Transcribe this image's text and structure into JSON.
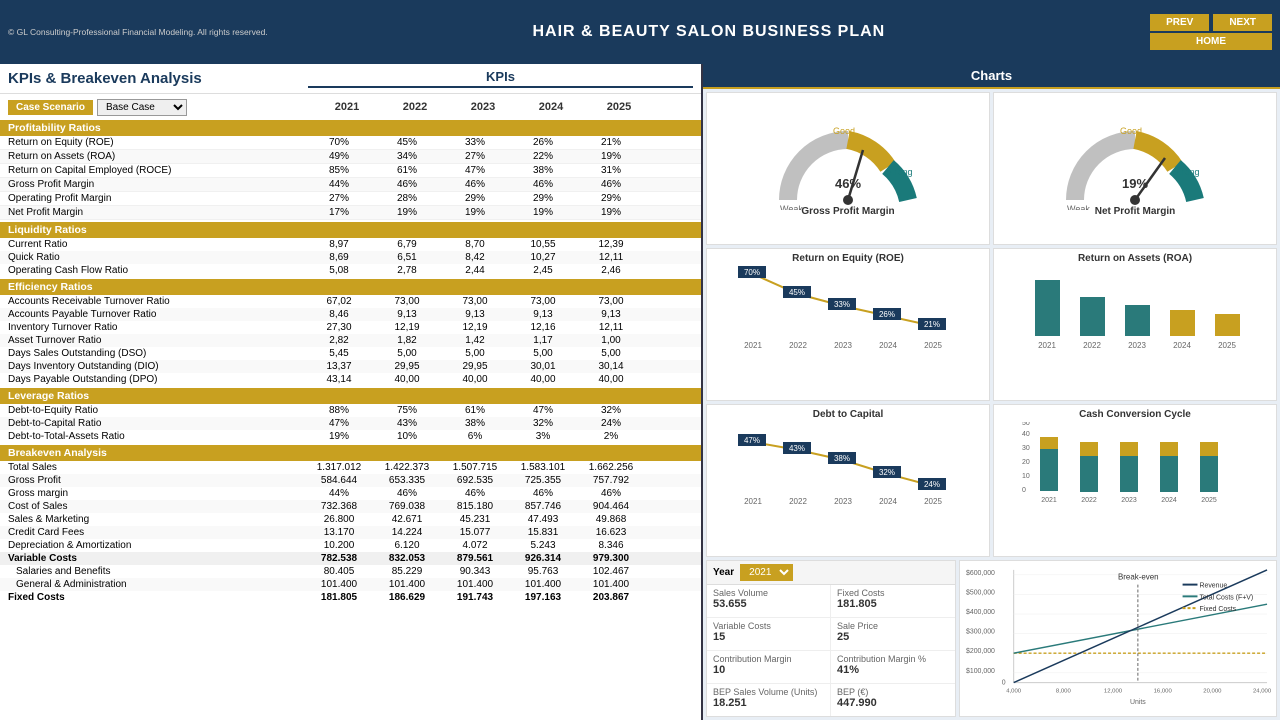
{
  "header": {
    "copyright": "© GL Consulting-Professional Financial Modeling. All rights reserved.",
    "title": "HAIR & BEAUTY SALON BUSINESS PLAN",
    "prev_label": "PREV",
    "next_label": "NEXT",
    "home_label": "HOME"
  },
  "page_title": "KPIs & Breakeven Analysis",
  "sections_header": {
    "kpis": "KPIs",
    "charts": "Charts"
  },
  "controls": {
    "case_btn": "Case Scenario",
    "case_value": "Base Case"
  },
  "years": [
    "2021",
    "2022",
    "2023",
    "2024",
    "2025"
  ],
  "profitability": {
    "header": "Profitability Ratios",
    "rows": [
      {
        "label": "Return on Equity (ROE)",
        "vals": [
          "70%",
          "45%",
          "33%",
          "26%",
          "21%"
        ]
      },
      {
        "label": "Return on Assets (ROA)",
        "vals": [
          "49%",
          "34%",
          "27%",
          "22%",
          "19%"
        ]
      },
      {
        "label": "Return on Capital Employed (ROCE)",
        "vals": [
          "85%",
          "61%",
          "47%",
          "38%",
          "31%"
        ]
      },
      {
        "label": "Gross Profit Margin",
        "vals": [
          "44%",
          "46%",
          "46%",
          "46%",
          "46%"
        ]
      },
      {
        "label": "Operating Profit Margin",
        "vals": [
          "27%",
          "28%",
          "29%",
          "29%",
          "29%"
        ]
      },
      {
        "label": "Net Profit Margin",
        "vals": [
          "17%",
          "19%",
          "19%",
          "19%",
          "19%"
        ]
      }
    ]
  },
  "liquidity": {
    "header": "Liquidity Ratios",
    "rows": [
      {
        "label": "Current Ratio",
        "vals": [
          "8,97",
          "6,79",
          "8,70",
          "10,55",
          "12,39"
        ]
      },
      {
        "label": "Quick Ratio",
        "vals": [
          "8,69",
          "6,51",
          "8,42",
          "10,27",
          "12,11"
        ]
      },
      {
        "label": "Operating Cash Flow Ratio",
        "vals": [
          "5,08",
          "2,78",
          "2,44",
          "2,45",
          "2,46"
        ]
      }
    ]
  },
  "efficiency": {
    "header": "Efficiency Ratios",
    "rows": [
      {
        "label": "Accounts Receivable Turnover Ratio",
        "vals": [
          "67,02",
          "73,00",
          "73,00",
          "73,00",
          "73,00"
        ]
      },
      {
        "label": "Accounts Payable Turnover Ratio",
        "vals": [
          "8,46",
          "9,13",
          "9,13",
          "9,13",
          "9,13"
        ]
      },
      {
        "label": "Inventory Turnover Ratio",
        "vals": [
          "27,30",
          "12,19",
          "12,19",
          "12,16",
          "12,11"
        ]
      },
      {
        "label": "Asset Turnover Ratio",
        "vals": [
          "2,82",
          "1,82",
          "1,42",
          "1,17",
          "1,00"
        ]
      },
      {
        "label": "Days Sales Outstanding (DSO)",
        "vals": [
          "5,45",
          "5,00",
          "5,00",
          "5,00",
          "5,00"
        ]
      },
      {
        "label": "Days Inventory Outstanding (DIO)",
        "vals": [
          "13,37",
          "29,95",
          "29,95",
          "30,01",
          "30,14"
        ]
      },
      {
        "label": "Days Payable Outstanding (DPO)",
        "vals": [
          "43,14",
          "40,00",
          "40,00",
          "40,00",
          "40,00"
        ]
      }
    ]
  },
  "leverage": {
    "header": "Leverage Ratios",
    "rows": [
      {
        "label": "Debt-to-Equity Ratio",
        "vals": [
          "88%",
          "75%",
          "61%",
          "47%",
          "32%"
        ]
      },
      {
        "label": "Debt-to-Capital Ratio",
        "vals": [
          "47%",
          "43%",
          "38%",
          "32%",
          "24%"
        ]
      },
      {
        "label": "Debt-to-Total-Assets Ratio",
        "vals": [
          "19%",
          "10%",
          "6%",
          "3%",
          "2%"
        ]
      }
    ]
  },
  "breakeven": {
    "header": "Breakeven Analysis",
    "rows": [
      {
        "label": "Total Sales",
        "vals": [
          "1.317.012",
          "1.422.373",
          "1.507.715",
          "1.583.101",
          "1.662.256"
        ],
        "bold": false
      },
      {
        "label": "Gross Profit",
        "vals": [
          "584.644",
          "653.335",
          "692.535",
          "725.355",
          "757.792"
        ],
        "bold": false
      },
      {
        "label": "Gross margin",
        "vals": [
          "44%",
          "46%",
          "46%",
          "46%",
          "46%"
        ],
        "bold": false
      },
      {
        "label": "Cost of Sales",
        "vals": [
          "732.368",
          "769.038",
          "815.180",
          "857.746",
          "904.464"
        ],
        "bold": false
      },
      {
        "label": "Sales & Marketing",
        "vals": [
          "26.800",
          "42.671",
          "45.231",
          "47.493",
          "49.868"
        ],
        "bold": false
      },
      {
        "label": "Credit Card Fees",
        "vals": [
          "13.170",
          "14.224",
          "15.077",
          "15.831",
          "16.623"
        ],
        "bold": false
      },
      {
        "label": "Depreciation & Amortization",
        "vals": [
          "10.200",
          "6.120",
          "4.072",
          "5.243",
          "8.346"
        ],
        "bold": false
      },
      {
        "label": "Variable Costs",
        "vals": [
          "782.538",
          "832.053",
          "879.561",
          "926.314",
          "979.300"
        ],
        "bold": true
      },
      {
        "label": "Salaries and Benefits",
        "vals": [
          "80.405",
          "85.229",
          "90.343",
          "95.763",
          "102.467"
        ],
        "bold": false,
        "indent": true
      },
      {
        "label": "General & Administration",
        "vals": [
          "101.400",
          "101.400",
          "101.400",
          "101.400",
          "101.400"
        ],
        "bold": false,
        "indent": true
      },
      {
        "label": "Fixed Costs",
        "vals": [
          "181.805",
          "186.629",
          "191.743",
          "197.163",
          "203.867"
        ],
        "bold": true
      }
    ]
  },
  "kpi_metrics": {
    "year_label": "Year",
    "year_value": "2021",
    "items": [
      {
        "label": "Sales Volume",
        "value": "53.655"
      },
      {
        "label": "Fixed Costs",
        "value": "181.805"
      },
      {
        "label": "Variable Costs",
        "value": "15"
      },
      {
        "label": "Sale Price",
        "value": "25"
      },
      {
        "label": "Contribution Margin",
        "value": "10"
      },
      {
        "label": "Contribution Margin %",
        "value": "41%"
      },
      {
        "label": "BEP Sales Volume (Units)",
        "value": "18.251"
      },
      {
        "label": "BEP (€)",
        "value": "447.990"
      }
    ]
  },
  "charts": {
    "gross_profit_gauge": {
      "title": "Gross Profit Margin",
      "value": "46%",
      "label_weak": "Weak",
      "label_good": "Good",
      "label_strong": "Strong"
    },
    "net_profit_gauge": {
      "title": "Net Profit Margin",
      "value": "19%",
      "label_weak": "Weak",
      "label_good": "Good",
      "label_strong": "Strong"
    },
    "roe_chart": {
      "title": "Return on Equity (ROE)",
      "values": [
        70,
        45,
        33,
        26,
        21
      ],
      "labels": [
        "2021",
        "2022",
        "2023",
        "2024",
        "2025"
      ],
      "badges": [
        "70%",
        "45%",
        "33%",
        "26%",
        "21%"
      ]
    },
    "roa_chart": {
      "title": "Return on Assets (ROA",
      "values": [
        49,
        34,
        27,
        22,
        19
      ],
      "labels": [
        "2021",
        "2022",
        "2023",
        "2024",
        "2025"
      ]
    },
    "debt_capital_chart": {
      "title": "Debt to Capital",
      "values": [
        47,
        43,
        38,
        32,
        24
      ],
      "labels": [
        "2021",
        "2022",
        "2023",
        "2024",
        "2025"
      ],
      "badges": [
        "47%",
        "43%",
        "38%",
        "32%",
        "24%"
      ]
    },
    "ccc_chart": {
      "title": "Cash Conversion Cycle",
      "y_max": 50,
      "values": [
        35,
        30,
        30,
        30,
        30
      ],
      "values2": [
        8,
        12,
        12,
        12,
        12
      ],
      "labels": [
        "2021",
        "2022",
        "2023",
        "2024",
        "2025"
      ]
    },
    "breakeven_chart": {
      "title": "Break-even",
      "x_labels": [
        "4,000",
        "8,000",
        "12,000",
        "16,000",
        "20,000",
        "24,000"
      ],
      "y_labels": [
        "$600,000",
        "$500,000",
        "$400,000",
        "$300,000",
        "$200,000",
        "$100,000",
        "0"
      ],
      "legend": [
        "Revenue",
        "Total Costs (F+V)",
        "Fixed Costs"
      ]
    }
  }
}
